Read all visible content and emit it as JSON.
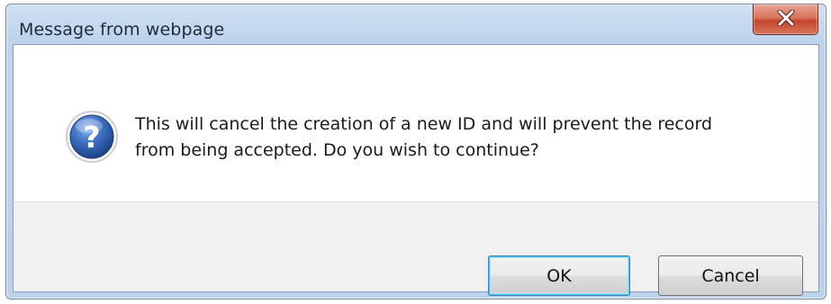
{
  "dialog": {
    "title": "Message from webpage",
    "message_line1": "This will cancel the creation of a new ID and will prevent the record",
    "message_line2": "from being accepted.  Do you wish to continue?",
    "icon": "question-icon",
    "close_icon": "close-icon",
    "buttons": {
      "ok_label": "OK",
      "cancel_label": "Cancel"
    }
  },
  "colors": {
    "titlebar": "#bed4ec",
    "close_button": "#c5452b",
    "button_bar": "#f0f0f0",
    "focus_ring": "#3c7fb1",
    "icon_blue": "#2a5aa8"
  }
}
